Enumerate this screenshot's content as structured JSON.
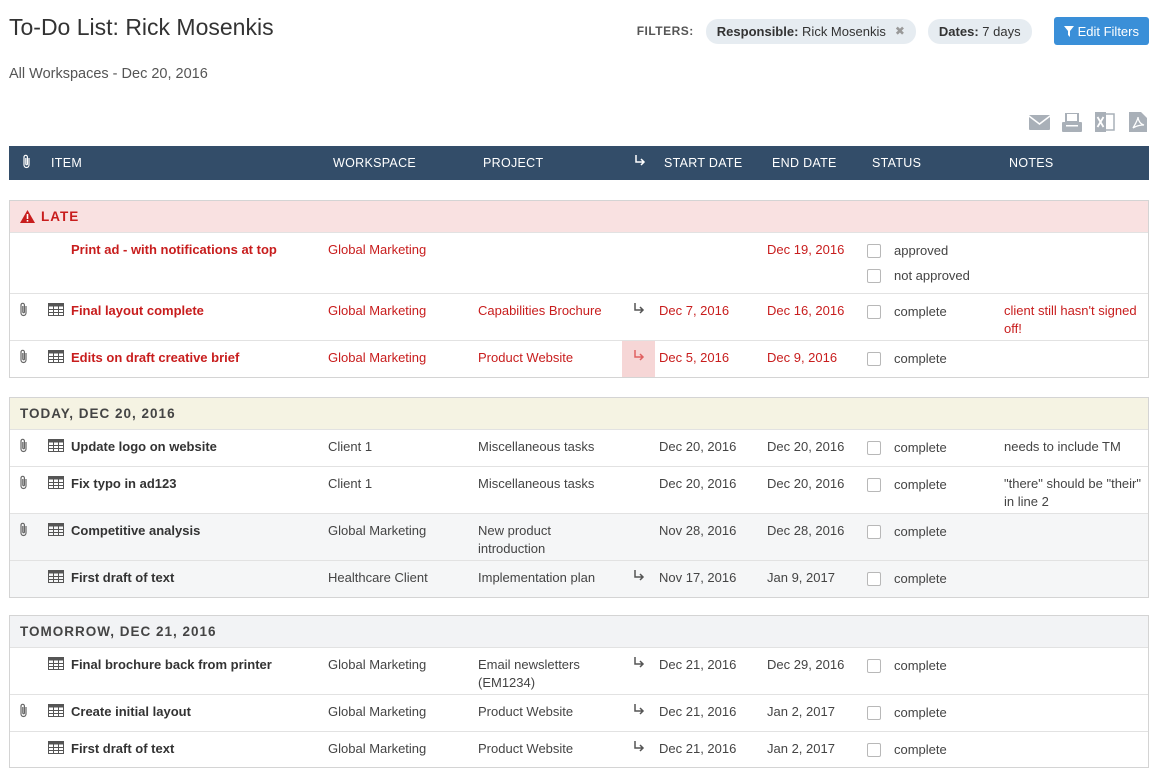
{
  "header": {
    "title": "To-Do List: Rick Mosenkis",
    "subtitle": "All Workspaces - Dec 20, 2016",
    "filters_label": "FILTERS:",
    "filter_chips": [
      {
        "key": "Responsible:",
        "value": "Rick Mosenkis"
      },
      {
        "key": "Dates:",
        "value": "7 days"
      }
    ],
    "edit_filters_label": "Edit Filters"
  },
  "export_icons": [
    "envelope-icon",
    "print-icon",
    "excel-icon",
    "pdf-icon"
  ],
  "columns": {
    "item": "ITEM",
    "workspace": "WORKSPACE",
    "project": "PROJECT",
    "start": "START DATE",
    "end": "END DATE",
    "status": "STATUS",
    "notes": "NOTES"
  },
  "colors": {
    "header_bg": "#334d69",
    "late": "#c81d1d",
    "button": "#3a8fd8"
  },
  "sections": {
    "late": {
      "label": "LATE",
      "rows": [
        {
          "item": "Print ad - with notifications at top",
          "workspace": "Global Marketing",
          "project": "",
          "start": "",
          "end": "Dec 19, 2016",
          "status": [
            "approved",
            "not approved"
          ],
          "notes": ""
        },
        {
          "item": "Final layout complete",
          "workspace": "Global Marketing",
          "project": "Capabilities Brochure",
          "start": "Dec 7, 2016",
          "end": "Dec 16, 2016",
          "status": [
            "complete"
          ],
          "notes": "client still hasn't signed off!"
        },
        {
          "item": "Edits on draft creative brief",
          "workspace": "Global Marketing",
          "project": "Product Website",
          "start": "Dec 5, 2016",
          "end": "Dec 9, 2016",
          "status": [
            "complete"
          ],
          "notes": ""
        }
      ]
    },
    "today": {
      "label": "TODAY, DEC 20, 2016",
      "rows": [
        {
          "item": "Update logo on website",
          "workspace": "Client 1",
          "project": "Miscellaneous tasks",
          "start": "Dec 20, 2016",
          "end": "Dec 20, 2016",
          "status": [
            "complete"
          ],
          "notes": "needs to include TM"
        },
        {
          "item": "Fix typo in ad123",
          "workspace": "Client 1",
          "project": "Miscellaneous tasks",
          "start": "Dec 20, 2016",
          "end": "Dec 20, 2016",
          "status": [
            "complete"
          ],
          "notes": "\"there\" should be \"their\" in line 2"
        },
        {
          "item": "Competitive analysis",
          "workspace": "Global Marketing",
          "project": "New product introduction",
          "start": "Nov 28, 2016",
          "end": "Dec 28, 2016",
          "status": [
            "complete"
          ],
          "notes": ""
        },
        {
          "item": "First draft of text",
          "workspace": "Healthcare Client",
          "project": "Implementation plan",
          "start": "Nov 17, 2016",
          "end": "Jan 9, 2017",
          "status": [
            "complete"
          ],
          "notes": ""
        }
      ]
    },
    "tomorrow": {
      "label": "TOMORROW, DEC 21, 2016",
      "rows": [
        {
          "item": "Final brochure back from printer",
          "workspace": "Global Marketing",
          "project": "Email newsletters (EM1234)",
          "start": "Dec 21, 2016",
          "end": "Dec 29, 2016",
          "status": [
            "complete"
          ],
          "notes": ""
        },
        {
          "item": "Create initial layout",
          "workspace": "Global Marketing",
          "project": "Product Website",
          "start": "Dec 21, 2016",
          "end": "Jan 2, 2017",
          "status": [
            "complete"
          ],
          "notes": ""
        },
        {
          "item": "First draft of text",
          "workspace": "Global Marketing",
          "project": "Product Website",
          "start": "Dec 21, 2016",
          "end": "Jan 2, 2017",
          "status": [
            "complete"
          ],
          "notes": ""
        }
      ]
    }
  }
}
